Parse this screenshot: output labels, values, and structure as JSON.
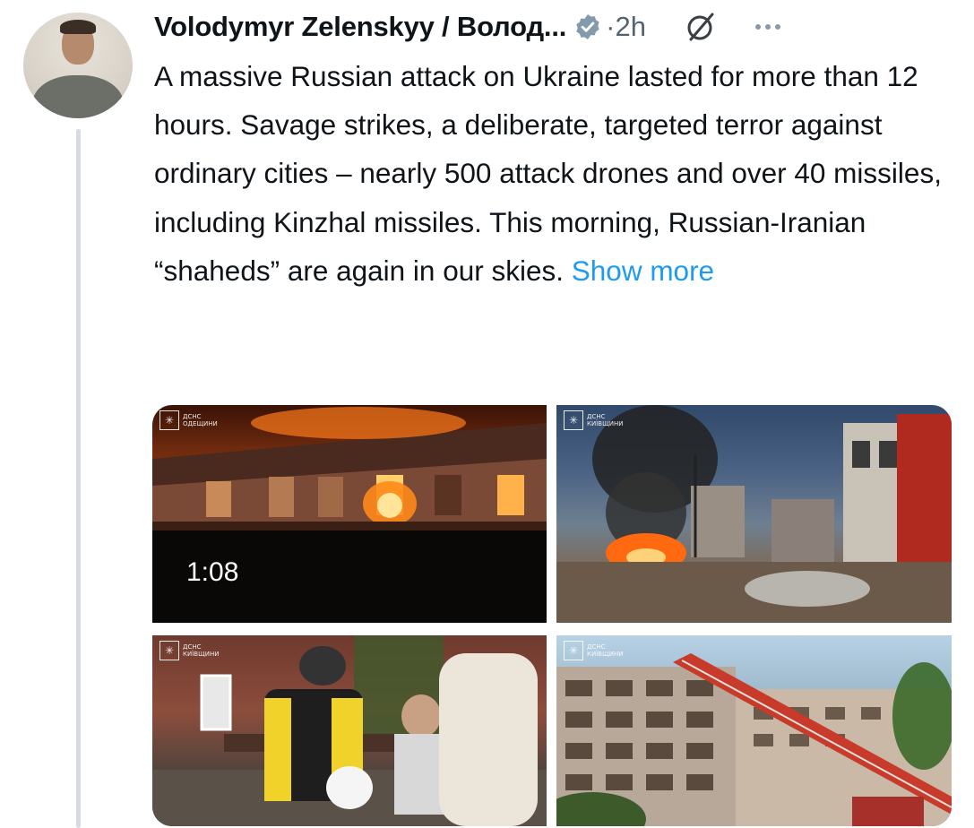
{
  "post": {
    "author": "Volodymyr Zelenskyy / Волод...",
    "separator": "·",
    "time": "2h",
    "text": "A massive Russian attack on Ukraine lasted for more than 12 hours. Savage strikes, a deliberate, targeted terror against ordinary cities – nearly 500 attack drones and over 40 missiles, including Kinzhal missiles. This morning, Russian-Iranian “shaheds” are again in our skies.",
    "show_more": "Show more",
    "icons": {
      "verified": "verified-badge-icon",
      "slash": "slash-circle-icon",
      "more": "more-options-icon"
    },
    "colors": {
      "link": "#1d9bf0",
      "secondary": "#536471",
      "verified": "#829aab"
    }
  },
  "media": {
    "video_duration": "1:08",
    "watermarks": [
      {
        "line1": "ДСНС",
        "line2": "ОДЕЩИНИ"
      },
      {
        "line1": "ДСНС",
        "line2": "КИЇВЩИНИ"
      },
      {
        "line1": "ДСНС",
        "line2": "КИЇВЩИНИ"
      },
      {
        "line1": "ДСНС",
        "line2": "КИЇВЩИНИ"
      }
    ]
  }
}
